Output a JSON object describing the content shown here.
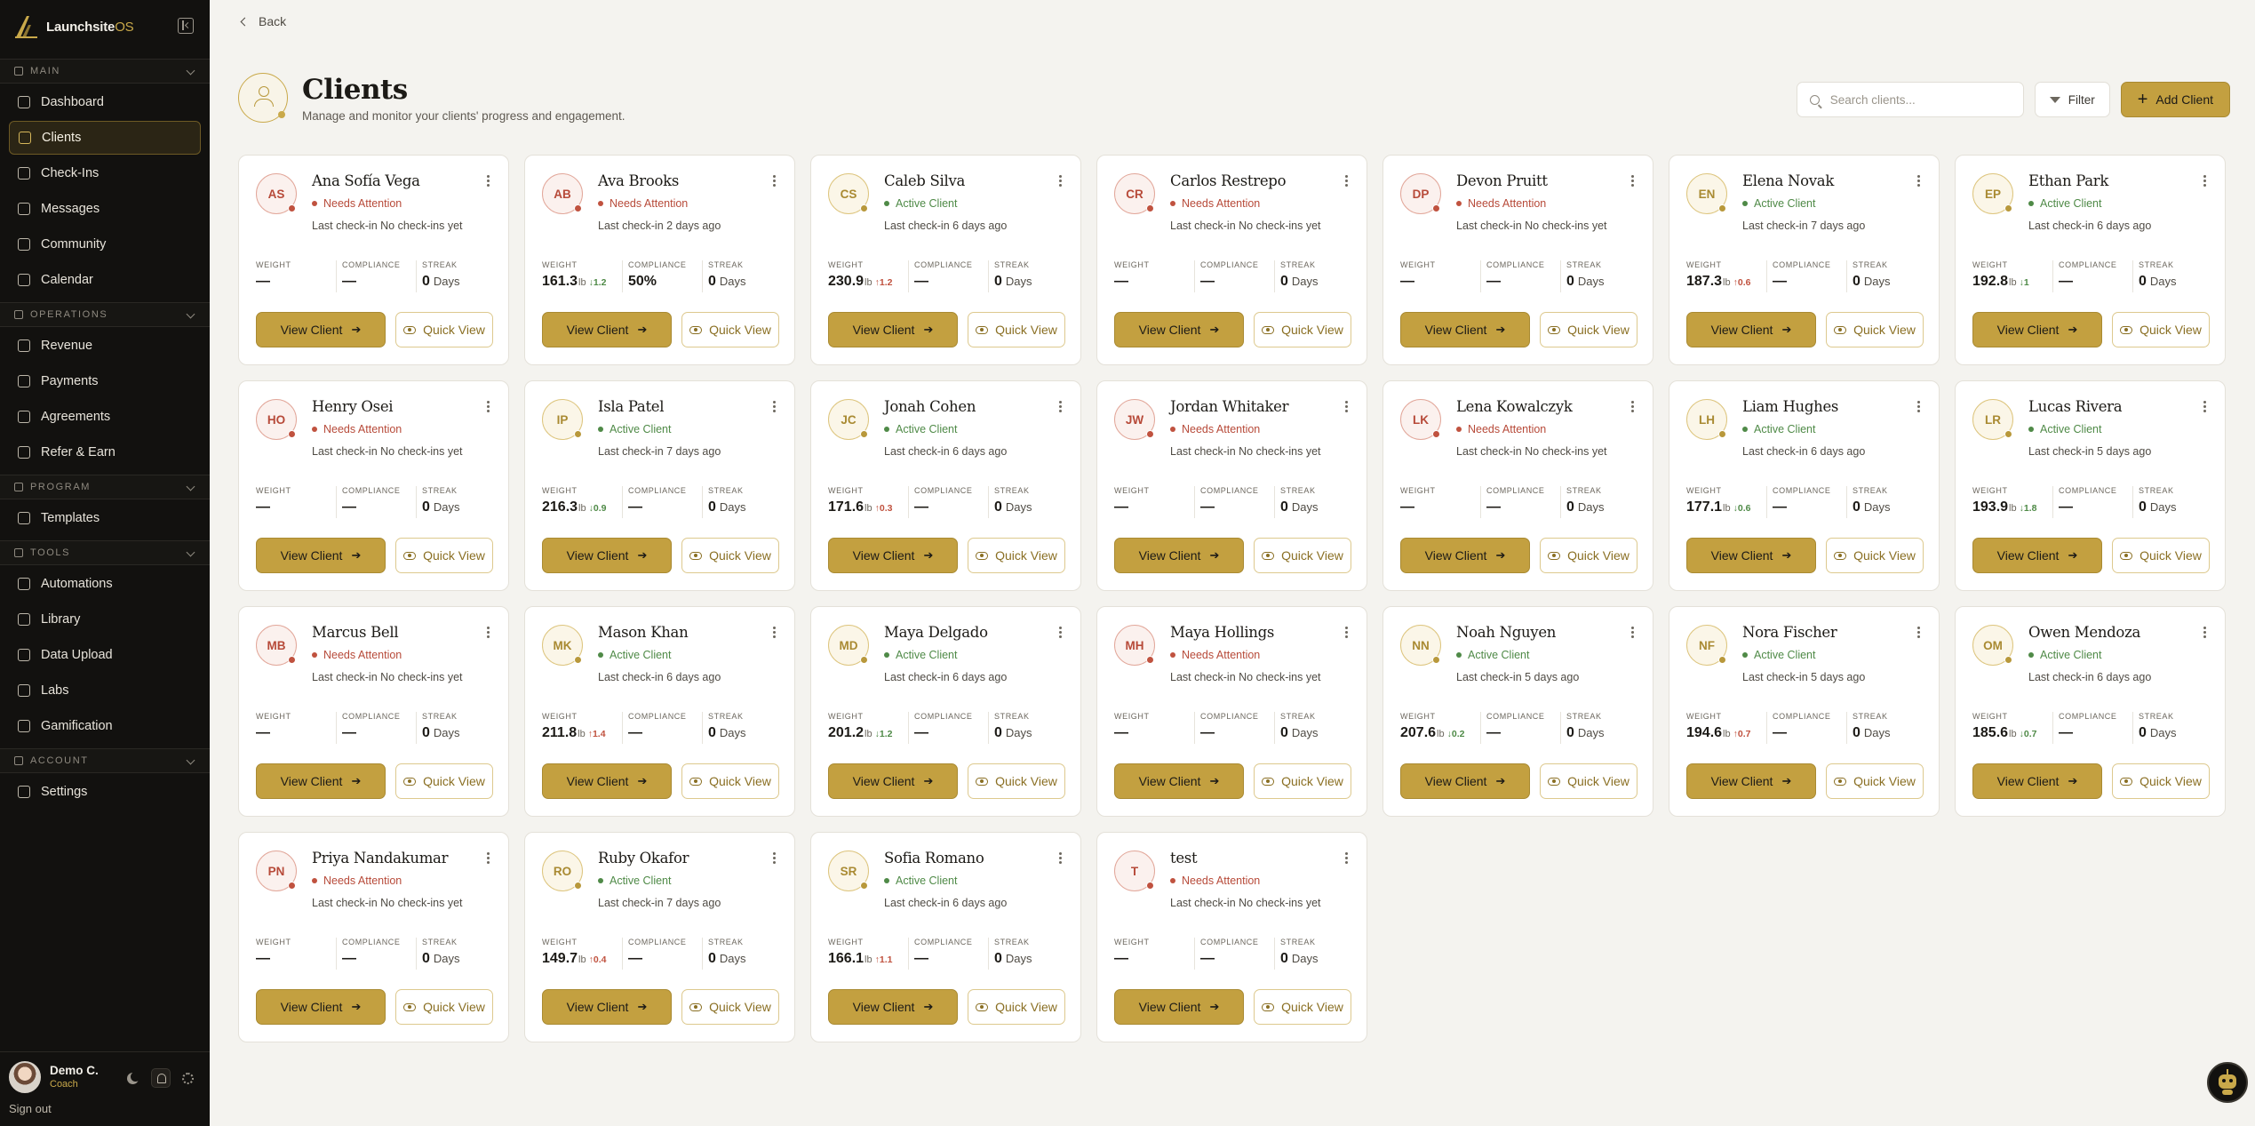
{
  "brand": {
    "name": "Launchsite",
    "suffix": "OS"
  },
  "sidebar": {
    "sections": [
      {
        "title": "MAIN",
        "items": [
          {
            "label": "Dashboard",
            "icon": "grid-icon",
            "active": false
          },
          {
            "label": "Clients",
            "icon": "clients-icon",
            "active": true
          },
          {
            "label": "Check-Ins",
            "icon": "clipboard-icon",
            "active": false
          },
          {
            "label": "Messages",
            "icon": "message-icon",
            "active": false
          },
          {
            "label": "Community",
            "icon": "community-icon",
            "active": false
          },
          {
            "label": "Calendar",
            "icon": "calendar-icon",
            "active": false
          }
        ]
      },
      {
        "title": "OPERATIONS",
        "items": [
          {
            "label": "Revenue",
            "icon": "revenue-icon",
            "active": false
          },
          {
            "label": "Payments",
            "icon": "card-icon",
            "active": false
          },
          {
            "label": "Agreements",
            "icon": "document-icon",
            "active": false
          },
          {
            "label": "Refer & Earn",
            "icon": "gift-icon",
            "active": false
          }
        ]
      },
      {
        "title": "PROGRAM",
        "items": [
          {
            "label": "Templates",
            "icon": "template-icon",
            "active": false
          }
        ]
      },
      {
        "title": "TOOLS",
        "items": [
          {
            "label": "Automations",
            "icon": "lightning-icon",
            "active": false
          },
          {
            "label": "Library",
            "icon": "book-icon",
            "active": false
          },
          {
            "label": "Data Upload",
            "icon": "upload-icon",
            "active": false
          },
          {
            "label": "Labs",
            "icon": "flask-icon",
            "active": false
          },
          {
            "label": "Gamification",
            "icon": "sparkle-icon",
            "active": false
          }
        ]
      },
      {
        "title": "ACCOUNT",
        "items": [
          {
            "label": "Settings",
            "icon": "gear-icon",
            "active": false
          }
        ]
      }
    ]
  },
  "profile": {
    "name": "Demo C.",
    "role": "Coach",
    "signout": "Sign out"
  },
  "back_label": "Back",
  "page": {
    "title": "Clients",
    "subtitle": "Manage and monitor your clients' progress and engagement."
  },
  "search": {
    "placeholder": "Search clients..."
  },
  "filter_label": "Filter",
  "add_label": "Add Client",
  "labels": {
    "weight": "WEIGHT",
    "compliance": "COMPLIANCE",
    "streak": "STREAK",
    "view": "View Client",
    "quick": "Quick View",
    "unit": "lb",
    "days": "Days",
    "last_prefix": "Last check-in "
  },
  "colors": {
    "accent": "#c3a040",
    "attention": "#c0523f",
    "active": "#4f8a47",
    "sidebar": "#12110f"
  },
  "clients": [
    {
      "initials": "AS",
      "name": "Ana Sofía Vega",
      "status": "Needs Attention",
      "state": "attn",
      "last": "No check-ins yet",
      "weight": "—",
      "delta": "",
      "dir": "",
      "compliance": "—",
      "streak": "0"
    },
    {
      "initials": "AB",
      "name": "Ava Brooks",
      "status": "Needs Attention",
      "state": "attn",
      "last": "2 days ago",
      "weight": "161.3",
      "delta": "↓1.2",
      "dir": "down",
      "compliance": "50%",
      "streak": "0"
    },
    {
      "initials": "CS",
      "name": "Caleb Silva",
      "status": "Active Client",
      "state": "active",
      "last": "6 days ago",
      "weight": "230.9",
      "delta": "↑1.2",
      "dir": "up",
      "compliance": "—",
      "streak": "0"
    },
    {
      "initials": "CR",
      "name": "Carlos Restrepo",
      "status": "Needs Attention",
      "state": "attn",
      "last": "No check-ins yet",
      "weight": "—",
      "delta": "",
      "dir": "",
      "compliance": "—",
      "streak": "0"
    },
    {
      "initials": "DP",
      "name": "Devon Pruitt",
      "status": "Needs Attention",
      "state": "attn",
      "last": "No check-ins yet",
      "weight": "—",
      "delta": "",
      "dir": "",
      "compliance": "—",
      "streak": "0"
    },
    {
      "initials": "EN",
      "name": "Elena Novak",
      "status": "Active Client",
      "state": "active",
      "last": "7 days ago",
      "weight": "187.3",
      "delta": "↑0.6",
      "dir": "up",
      "compliance": "—",
      "streak": "0"
    },
    {
      "initials": "EP",
      "name": "Ethan Park",
      "status": "Active Client",
      "state": "active",
      "last": "6 days ago",
      "weight": "192.8",
      "delta": "↓1",
      "dir": "down",
      "compliance": "—",
      "streak": "0"
    },
    {
      "initials": "HO",
      "name": "Henry Osei",
      "status": "Needs Attention",
      "state": "attn",
      "last": "No check-ins yet",
      "weight": "—",
      "delta": "",
      "dir": "",
      "compliance": "—",
      "streak": "0"
    },
    {
      "initials": "IP",
      "name": "Isla Patel",
      "status": "Active Client",
      "state": "active",
      "last": "7 days ago",
      "weight": "216.3",
      "delta": "↓0.9",
      "dir": "down",
      "compliance": "—",
      "streak": "0"
    },
    {
      "initials": "JC",
      "name": "Jonah Cohen",
      "status": "Active Client",
      "state": "active",
      "last": "6 days ago",
      "weight": "171.6",
      "delta": "↑0.3",
      "dir": "up",
      "compliance": "—",
      "streak": "0"
    },
    {
      "initials": "JW",
      "name": "Jordan Whitaker",
      "status": "Needs Attention",
      "state": "attn",
      "last": "No check-ins yet",
      "weight": "—",
      "delta": "",
      "dir": "",
      "compliance": "—",
      "streak": "0"
    },
    {
      "initials": "LK",
      "name": "Lena Kowalczyk",
      "status": "Needs Attention",
      "state": "attn",
      "last": "No check-ins yet",
      "weight": "—",
      "delta": "",
      "dir": "",
      "compliance": "—",
      "streak": "0"
    },
    {
      "initials": "LH",
      "name": "Liam Hughes",
      "status": "Active Client",
      "state": "active",
      "last": "6 days ago",
      "weight": "177.1",
      "delta": "↓0.6",
      "dir": "down",
      "compliance": "—",
      "streak": "0"
    },
    {
      "initials": "LR",
      "name": "Lucas Rivera",
      "status": "Active Client",
      "state": "active",
      "last": "5 days ago",
      "weight": "193.9",
      "delta": "↓1.8",
      "dir": "down",
      "compliance": "—",
      "streak": "0"
    },
    {
      "initials": "MB",
      "name": "Marcus Bell",
      "status": "Needs Attention",
      "state": "attn",
      "last": "No check-ins yet",
      "weight": "—",
      "delta": "",
      "dir": "",
      "compliance": "—",
      "streak": "0"
    },
    {
      "initials": "MK",
      "name": "Mason Khan",
      "status": "Active Client",
      "state": "active",
      "last": "6 days ago",
      "weight": "211.8",
      "delta": "↑1.4",
      "dir": "up",
      "compliance": "—",
      "streak": "0"
    },
    {
      "initials": "MD",
      "name": "Maya Delgado",
      "status": "Active Client",
      "state": "active",
      "last": "6 days ago",
      "weight": "201.2",
      "delta": "↓1.2",
      "dir": "down",
      "compliance": "—",
      "streak": "0"
    },
    {
      "initials": "MH",
      "name": "Maya Hollings",
      "status": "Needs Attention",
      "state": "attn",
      "last": "No check-ins yet",
      "weight": "—",
      "delta": "",
      "dir": "",
      "compliance": "—",
      "streak": "0"
    },
    {
      "initials": "NN",
      "name": "Noah Nguyen",
      "status": "Active Client",
      "state": "active",
      "last": "5 days ago",
      "weight": "207.6",
      "delta": "↓0.2",
      "dir": "down",
      "compliance": "—",
      "streak": "0"
    },
    {
      "initials": "NF",
      "name": "Nora Fischer",
      "status": "Active Client",
      "state": "active",
      "last": "5 days ago",
      "weight": "194.6",
      "delta": "↑0.7",
      "dir": "up",
      "compliance": "—",
      "streak": "0"
    },
    {
      "initials": "OM",
      "name": "Owen Mendoza",
      "status": "Active Client",
      "state": "active",
      "last": "6 days ago",
      "weight": "185.6",
      "delta": "↓0.7",
      "dir": "down",
      "compliance": "—",
      "streak": "0"
    },
    {
      "initials": "PN",
      "name": "Priya Nandakumar",
      "status": "Needs Attention",
      "state": "attn",
      "last": "No check-ins yet",
      "weight": "—",
      "delta": "",
      "dir": "",
      "compliance": "—",
      "streak": "0"
    },
    {
      "initials": "RO",
      "name": "Ruby Okafor",
      "status": "Active Client",
      "state": "active",
      "last": "7 days ago",
      "weight": "149.7",
      "delta": "↑0.4",
      "dir": "up",
      "compliance": "—",
      "streak": "0"
    },
    {
      "initials": "SR",
      "name": "Sofia Romano",
      "status": "Active Client",
      "state": "active",
      "last": "6 days ago",
      "weight": "166.1",
      "delta": "↑1.1",
      "dir": "up",
      "compliance": "—",
      "streak": "0"
    },
    {
      "initials": "T",
      "name": "test",
      "status": "Needs Attention",
      "state": "attn",
      "last": "No check-ins yet",
      "weight": "—",
      "delta": "",
      "dir": "",
      "compliance": "—",
      "streak": "0"
    }
  ]
}
